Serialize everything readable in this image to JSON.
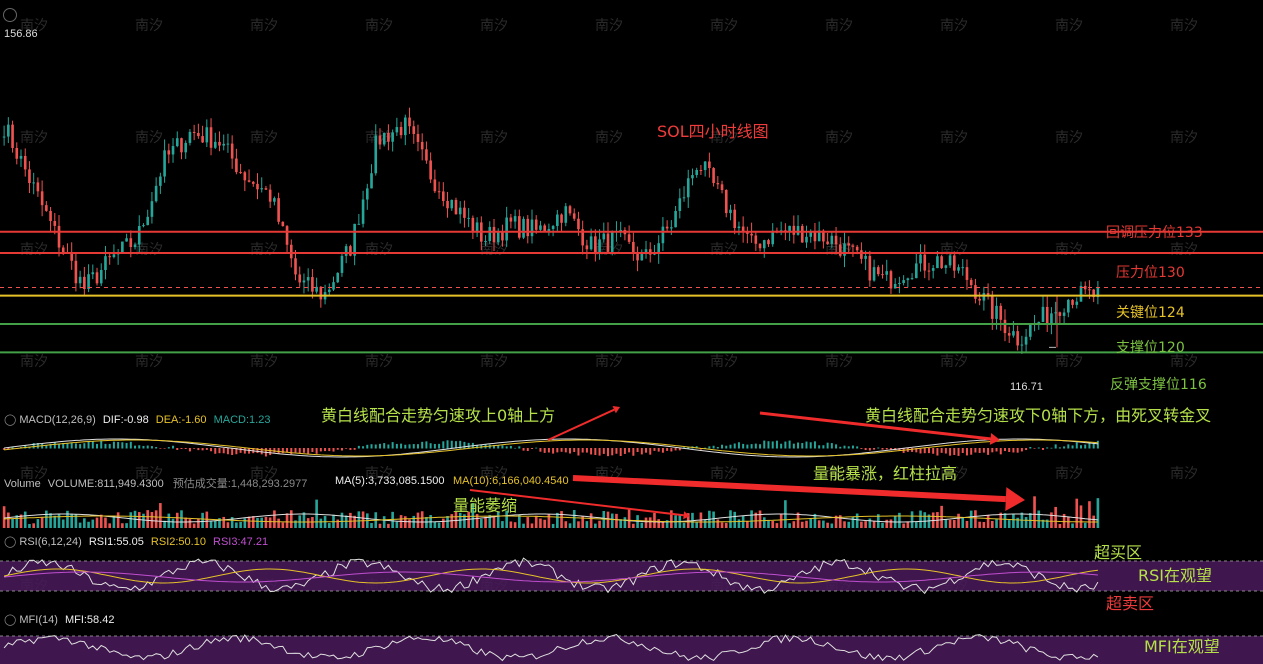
{
  "chart_data": {
    "type": "candlestick",
    "title": "SOL四小时线图",
    "price_range": [
      110,
      160
    ],
    "top_price_label": "156.86",
    "low_price_label": "116.71",
    "levels": [
      {
        "name": "回调压力位133",
        "value": 133,
        "color": "#e53935"
      },
      {
        "name": "压力位130",
        "value": 130,
        "color": "#e53935"
      },
      {
        "name": "关键位124",
        "value": 124,
        "color": "#e6c229"
      },
      {
        "name": "支撑位120",
        "value": 120,
        "color": "#43a047"
      },
      {
        "name": "反弹支撑位116",
        "value": 116,
        "color": "#43a047"
      }
    ],
    "colors": {
      "up": "#26a69a",
      "down": "#ef5350"
    },
    "key_closes": [
      148,
      140,
      132,
      125,
      129,
      132,
      143,
      147,
      146,
      141,
      138,
      126,
      124,
      131,
      146,
      148,
      141,
      136,
      132,
      134,
      133,
      136,
      131,
      132,
      129,
      134,
      143,
      137,
      131,
      133,
      133,
      132,
      129,
      126,
      128,
      129,
      127,
      122,
      118,
      121,
      124,
      124
    ]
  },
  "macd": {
    "title": "MACD(12,26,9)",
    "dif": "DIF:-0.98",
    "dea": "DEA:-1.60",
    "macd": "MACD:1.23"
  },
  "volume": {
    "title": "Volume",
    "volume": "VOLUME:811,949.4300",
    "forecast": "预估成交量:1,448,293.2977",
    "ma5": "MA(5):3,733,085.1500",
    "ma10": "MA(10):6,166,040.4540"
  },
  "rsi": {
    "title": "RSI(6,12,24)",
    "rsi1": "RSI1:55.05",
    "rsi2": "RSI2:50.10",
    "rsi3": "RSI3:47.21"
  },
  "mfi": {
    "title": "MFI(14)",
    "value": "MFI:58.42"
  },
  "annotations": {
    "macd_left": "黄白线配合走势匀速攻上0轴上方",
    "macd_right": "黄白线配合走势匀速攻下0轴下方，由死叉转金叉",
    "vol_up": "量能暴涨，红柱拉高",
    "vol_shrink": "量能萎缩",
    "overbought": "超买区",
    "rsi_watch": "RSI在观望",
    "oversold": "超卖区",
    "mfi_watch": "MFI在观望"
  },
  "watermark": "南汐"
}
